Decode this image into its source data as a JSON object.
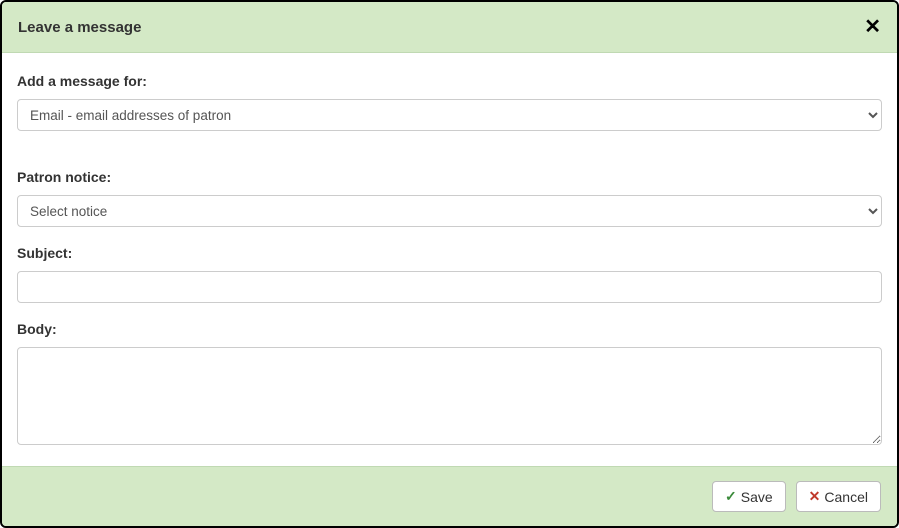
{
  "header": {
    "title": "Leave a message"
  },
  "form": {
    "message_for": {
      "label": "Add a message for:",
      "selected": "Email - email addresses of patron"
    },
    "patron_notice": {
      "label": "Patron notice:",
      "selected": "Select notice"
    },
    "subject": {
      "label": "Subject:",
      "value": ""
    },
    "body": {
      "label": "Body:",
      "value": ""
    }
  },
  "footer": {
    "save_label": "Save",
    "cancel_label": "Cancel"
  }
}
